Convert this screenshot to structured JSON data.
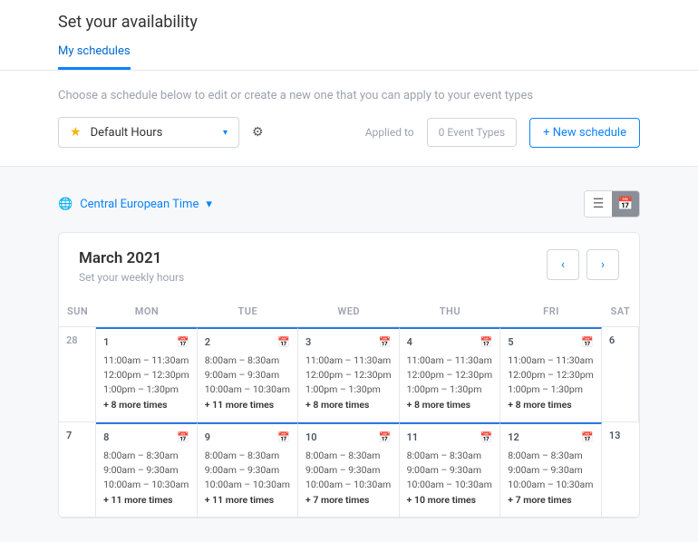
{
  "header": {
    "title": "Set your availability",
    "tab": "My schedules"
  },
  "sub": {
    "text": "Choose a schedule below to edit or create a new one that you can apply to your event types",
    "dropdown": "Default Hours",
    "applied_label": "Applied to",
    "applied_value": "0 Event Types",
    "new_btn": "+  New schedule"
  },
  "tz": "Central European Time",
  "cal": {
    "month": "March 2021",
    "sub": "Set your weekly hours",
    "dh": [
      "SUN",
      "MON",
      "TUE",
      "WED",
      "THU",
      "FRI",
      "SAT"
    ],
    "rows": [
      [
        {
          "n": "28",
          "dim": true
        },
        {
          "n": "1",
          "hl": true,
          "ico": true,
          "slots": [
            "11:00am – 11:30am",
            "12:00pm – 12:30pm",
            "1:00pm – 1:30pm"
          ],
          "more": "+ 8 more times"
        },
        {
          "n": "2",
          "hl": true,
          "ico": true,
          "slots": [
            "8:00am – 8:30am",
            "9:00am – 9:30am",
            "10:00am – 10:30am"
          ],
          "more": "+ 11 more times"
        },
        {
          "n": "3",
          "hl": true,
          "ico": true,
          "slots": [
            "11:00am – 11:30am",
            "12:00pm – 12:30pm",
            "1:00pm – 1:30pm"
          ],
          "more": "+ 8 more times"
        },
        {
          "n": "4",
          "hl": true,
          "ico": true,
          "slots": [
            "11:00am – 11:30am",
            "12:00pm – 12:30pm",
            "1:00pm – 1:30pm"
          ],
          "more": "+ 8 more times"
        },
        {
          "n": "5",
          "hl": true,
          "ico": true,
          "slots": [
            "11:00am – 11:30am",
            "12:00pm – 12:30pm",
            "1:00pm – 1:30pm"
          ],
          "more": "+ 8 more times"
        },
        {
          "n": "6"
        }
      ],
      [
        {
          "n": "7"
        },
        {
          "n": "8",
          "hl": true,
          "ico": true,
          "slots": [
            "8:00am – 8:30am",
            "9:00am – 9:30am",
            "10:00am – 10:30am"
          ],
          "more": "+ 11 more times"
        },
        {
          "n": "9",
          "hl": true,
          "ico": true,
          "slots": [
            "8:00am – 8:30am",
            "9:00am – 9:30am",
            "10:00am – 10:30am"
          ],
          "more": "+ 11 more times"
        },
        {
          "n": "10",
          "hl": true,
          "ico": true,
          "slots": [
            "8:00am – 8:30am",
            "9:00am – 9:30am",
            "10:00am – 10:30am"
          ],
          "more": "+ 7 more times"
        },
        {
          "n": "11",
          "hl": true,
          "ico": true,
          "slots": [
            "8:00am – 8:30am",
            "9:00am – 9:30am",
            "10:00am – 10:30am"
          ],
          "more": "+ 10 more times"
        },
        {
          "n": "12",
          "hl": true,
          "ico": true,
          "slots": [
            "8:00am – 8:30am",
            "9:00am – 9:30am",
            "10:00am – 10:30am"
          ],
          "more": "+ 7 more times"
        },
        {
          "n": "13"
        }
      ]
    ]
  }
}
